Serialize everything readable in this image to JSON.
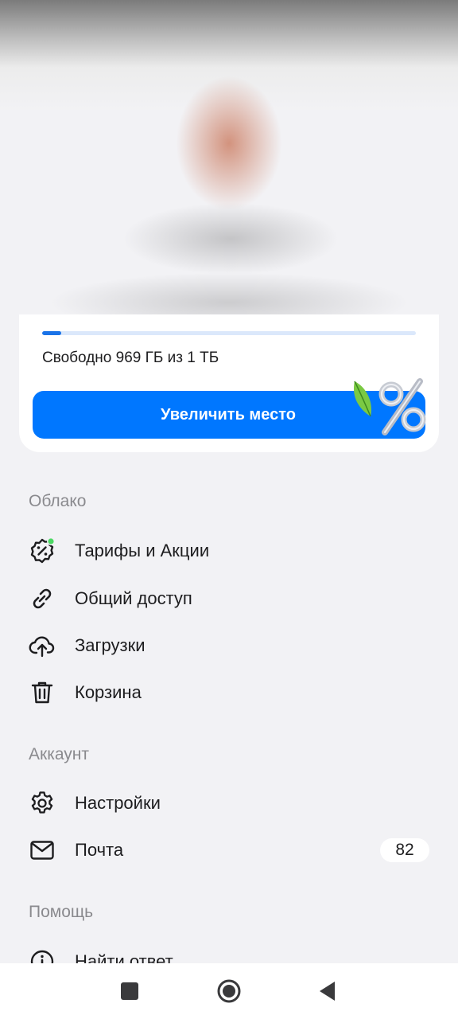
{
  "storage": {
    "used_fraction": 0.05,
    "free_text": "Свободно 969 ГБ из 1 ТБ",
    "upgrade_label": "Увеличить место"
  },
  "sections": {
    "cloud": {
      "title": "Облако",
      "items": [
        {
          "label": "Тарифы и Акции",
          "icon": "percent-badge-icon"
        },
        {
          "label": "Общий доступ",
          "icon": "link-icon"
        },
        {
          "label": "Загрузки",
          "icon": "upload-cloud-icon"
        },
        {
          "label": "Корзина",
          "icon": "trash-icon"
        }
      ]
    },
    "account": {
      "title": "Аккаунт",
      "items": [
        {
          "label": "Настройки",
          "icon": "gear-icon"
        },
        {
          "label": "Почта",
          "icon": "mail-icon",
          "badge": "82"
        }
      ]
    },
    "help": {
      "title": "Помощь",
      "items": [
        {
          "label": "Найти ответ",
          "icon": "info-icon"
        }
      ]
    }
  },
  "colors": {
    "accent": "#0077ff",
    "status_dot": "#4cd964",
    "background": "#f2f2f5"
  },
  "navbar": {
    "icons": [
      "recent-apps-icon",
      "home-icon",
      "back-icon"
    ]
  }
}
